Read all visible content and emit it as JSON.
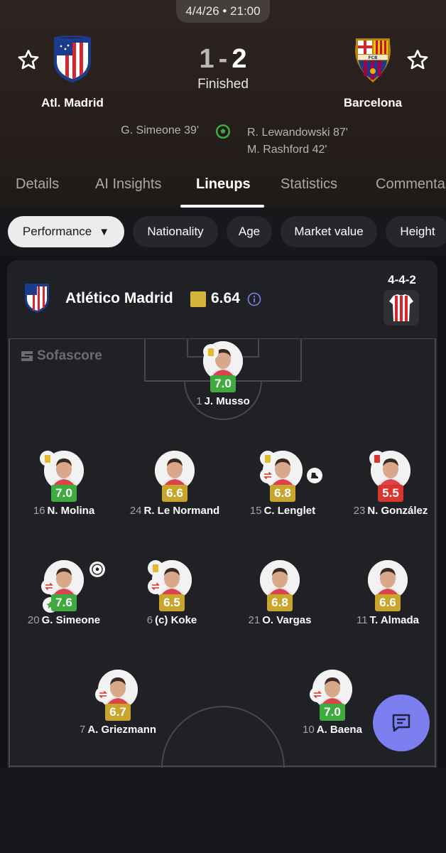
{
  "match": {
    "datetime": "4/4/26 • 21:00",
    "home_team": "Atl. Madrid",
    "away_team": "Barcelona",
    "home_score": "1",
    "away_score": "2",
    "separator": "-",
    "status": "Finished",
    "home_scorers": [
      "G. Simeone 39'"
    ],
    "away_scorers": [
      "R. Lewandowski 87'",
      "M. Rashford 42'"
    ]
  },
  "tabs": [
    "Details",
    "AI Insights",
    "Lineups",
    "Statistics",
    "Commentary"
  ],
  "active_tab": "Lineups",
  "filters": {
    "performance": "Performance",
    "nationality": "Nationality",
    "age": "Age",
    "market_value": "Market value",
    "height": "Height"
  },
  "lineup": {
    "team": "Atlético Madrid",
    "team_rating": "6.64",
    "formation": "4-4-2",
    "watermark": "Sofascore",
    "players": [
      {
        "number": "1",
        "name": "J. Musso",
        "rating": "7.0",
        "color": "green"
      },
      {
        "number": "16",
        "name": "N. Molina",
        "rating": "7.0",
        "color": "green"
      },
      {
        "number": "24",
        "name": "R. Le Normand",
        "rating": "6.6",
        "color": "yellow"
      },
      {
        "number": "15",
        "name": "C. Lenglet",
        "rating": "6.8",
        "color": "yellow"
      },
      {
        "number": "23",
        "name": "N. González",
        "rating": "5.5",
        "color": "red"
      },
      {
        "number": "20",
        "name": "G. Simeone",
        "rating": "7.6",
        "color": "green"
      },
      {
        "number": "6",
        "name": "(c) Koke",
        "rating": "6.5",
        "color": "yellow"
      },
      {
        "number": "21",
        "name": "O. Vargas",
        "rating": "6.8",
        "color": "yellow"
      },
      {
        "number": "11",
        "name": "T. Almada",
        "rating": "6.6",
        "color": "yellow"
      },
      {
        "number": "7",
        "name": "A. Griezmann",
        "rating": "6.7",
        "color": "yellow"
      },
      {
        "number": "10",
        "name": "A. Baena",
        "rating": "7.0",
        "color": "green"
      }
    ]
  },
  "colors": {
    "rating_green": "#3fab3f",
    "rating_yellow": "#c9a52d",
    "rating_red": "#d8352c",
    "fab": "#7b7ff0"
  }
}
